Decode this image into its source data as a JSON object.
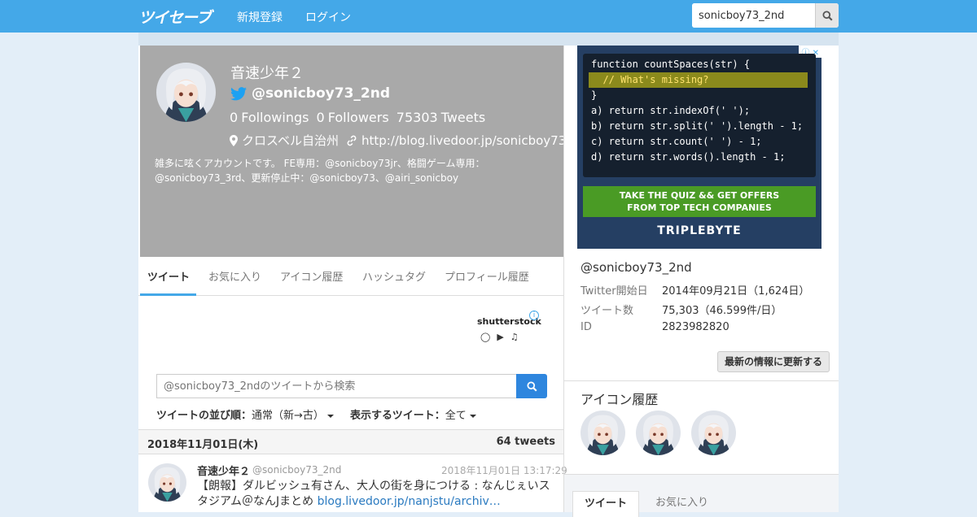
{
  "nav": {
    "logo": "ツイセーブ",
    "signup": "新規登録",
    "login": "ログイン",
    "search_value": "sonicboy73_2nd"
  },
  "profile": {
    "name": "音速少年２",
    "handle": "@sonicboy73_2nd",
    "followings_count": "0",
    "followings_label": "Followings",
    "followers_count": "0",
    "followers_label": "Followers",
    "tweets_count": "75303",
    "tweets_label": "Tweets",
    "location": "クロスベル自治州",
    "url": "http://blog.livedoor.jp/sonicboy73",
    "bio": "雑多に呟くアカウントです。 FE専用：@sonicboy73jr、格闘ゲーム専用：@sonicboy73_3rd、更新停止中：@sonicboy73、@airi_sonicboy"
  },
  "tabs": [
    "ツイート",
    "お気に入り",
    "アイコン履歴",
    "ハッシュタグ",
    "プロフィール履歴"
  ],
  "shutterstock": {
    "logo": "shutterstock"
  },
  "tweet_search": {
    "placeholder": "@sonicboy73_2ndのツイートから検索"
  },
  "sort": {
    "order_label": "ツイートの並び順：",
    "order_value": "通常（新→古）",
    "show_label": "表示するツイート：",
    "show_value": "全て"
  },
  "date_header": {
    "date": "2018年11月01日(木)",
    "count": "64 tweets"
  },
  "tweet": {
    "name": "音速少年２",
    "handle": "@sonicboy73_2nd",
    "time": "2018年11月01日 13:17:29",
    "text": "【朗報】ダルビッシュ有さん、大人の街を身につける : なんじぇいスタジアム＠なんJまとめ ",
    "link": "blog.livedoor.jp/nanjstu/archiv…"
  },
  "ad": {
    "code_lines": [
      "function countSpaces(str) {",
      "  // What's missing?",
      "}",
      "a) return str.indexOf(' ');",
      "b) return str.split(' ').length - 1;",
      "c) return str.count(' ') - 1;",
      "d) return str.words().length - 1;"
    ],
    "cta_line1": "TAKE THE QUIZ && GET OFFERS",
    "cta_line2": "FROM TOP TECH COMPANIES",
    "brand": "TRIPLEBYTE"
  },
  "sidebar": {
    "handle": "@sonicboy73_2nd",
    "info": [
      {
        "key": "Twitter開始日",
        "value": "2014年09月21日（1,624日）"
      },
      {
        "key": "ツイート数",
        "value": "75,303（46.599件/日）"
      },
      {
        "key": "ID",
        "value": "2823982820"
      }
    ],
    "refresh": "最新の情報に更新する",
    "icon_history_title": "アイコン履歴",
    "bottom_tabs": [
      "ツイート",
      "お気に入り"
    ]
  },
  "colors": {
    "nav": "#44a8e8",
    "hero": "#a9a9a9",
    "link": "#2a7ac0"
  }
}
